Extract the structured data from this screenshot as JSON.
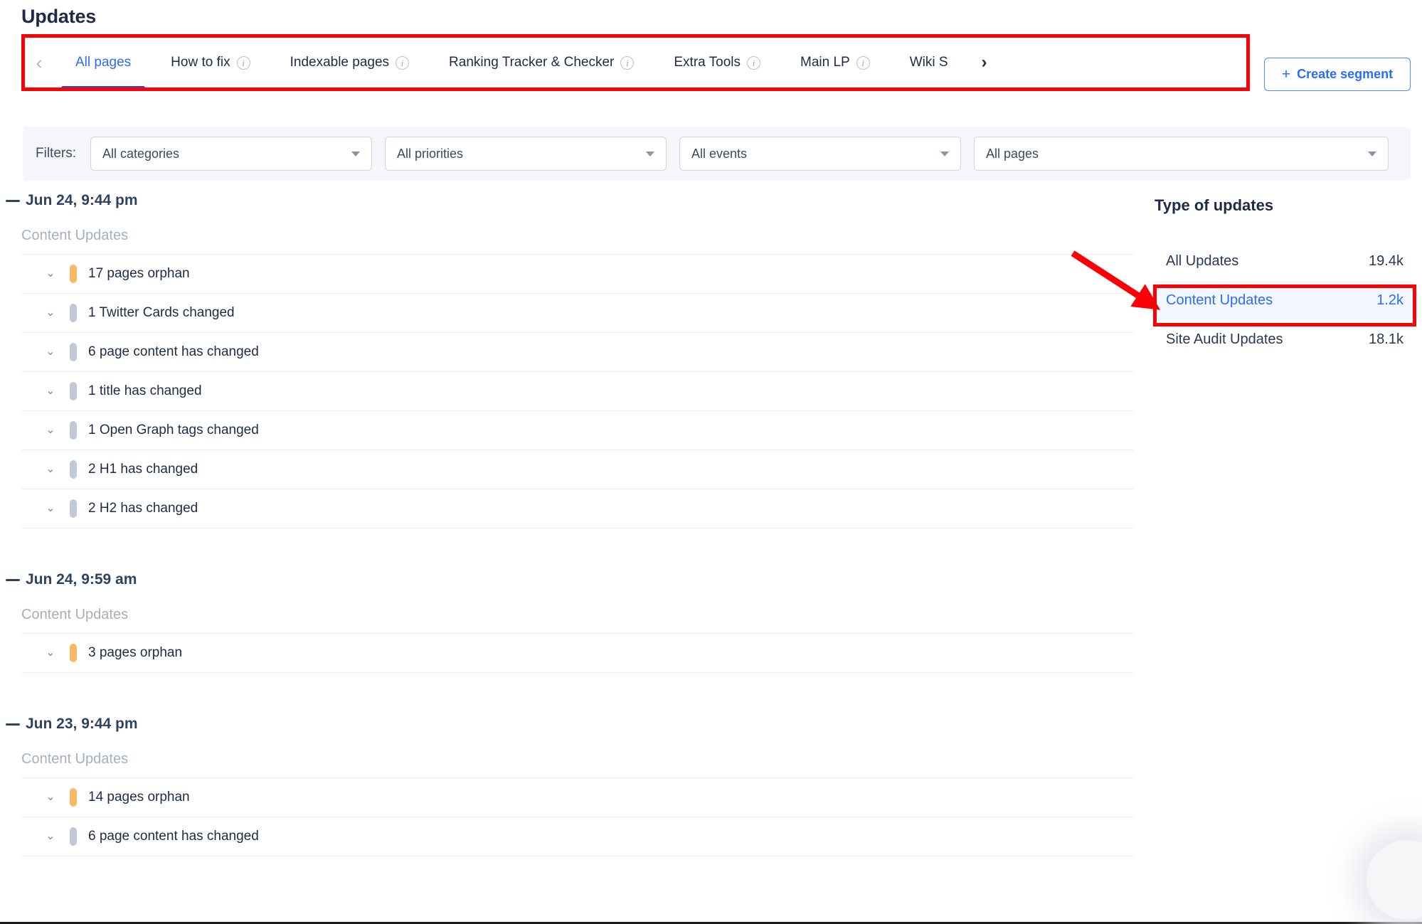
{
  "header": {
    "title": "Updates"
  },
  "tabs": {
    "prev_icon": "chevron-left-icon",
    "next_icon": "chevron-right-icon",
    "items": [
      {
        "label": "All pages",
        "active": true,
        "has_info": false
      },
      {
        "label": "How to fix",
        "active": false,
        "has_info": true
      },
      {
        "label": "Indexable pages",
        "active": false,
        "has_info": true
      },
      {
        "label": "Ranking Tracker & Checker",
        "active": false,
        "has_info": true
      },
      {
        "label": "Extra Tools",
        "active": false,
        "has_info": true
      },
      {
        "label": "Main LP",
        "active": false,
        "has_info": true
      },
      {
        "label": "Wiki S",
        "active": false,
        "has_info": false
      }
    ],
    "create_segment_label": "Create segment",
    "create_segment_plus": "+"
  },
  "filters": {
    "label": "Filters:",
    "selects": [
      {
        "value": "All categories",
        "placeholder": "All categories"
      },
      {
        "value": "All priorities",
        "placeholder": "All priorities"
      },
      {
        "value": "All events",
        "placeholder": "All events"
      },
      {
        "value": "All pages",
        "placeholder": "All pages"
      }
    ]
  },
  "timeline": {
    "groups": [
      {
        "date": "Jun 24, 9:44 pm",
        "section_label": "Content Updates",
        "rows": [
          {
            "label": "17 pages orphan",
            "severity": "orange"
          },
          {
            "label": "1 Twitter Cards changed",
            "severity": "grey"
          },
          {
            "label": "6 page content has changed",
            "severity": "grey"
          },
          {
            "label": "1 title has changed",
            "severity": "grey"
          },
          {
            "label": "1 Open Graph tags changed",
            "severity": "grey"
          },
          {
            "label": "2 H1 has changed",
            "severity": "grey"
          },
          {
            "label": "2 H2 has changed",
            "severity": "grey"
          }
        ]
      },
      {
        "date": "Jun 24, 9:59 am",
        "section_label": "Content Updates",
        "rows": [
          {
            "label": "3 pages orphan",
            "severity": "orange"
          }
        ]
      },
      {
        "date": "Jun 23, 9:44 pm",
        "section_label": "Content Updates",
        "rows": [
          {
            "label": "14 pages orphan",
            "severity": "orange"
          },
          {
            "label": "6 page content has changed",
            "severity": "grey"
          }
        ]
      }
    ]
  },
  "type_of_updates": {
    "title": "Type of updates",
    "items": [
      {
        "label": "All Updates",
        "count": "19.4k",
        "selected": false
      },
      {
        "label": "Content Updates",
        "count": "1.2k",
        "selected": true
      },
      {
        "label": "Site Audit Updates",
        "count": "18.1k",
        "selected": false
      }
    ]
  },
  "colors": {
    "accent_blue": "#2b6df6",
    "annotation_red": "#fb0007",
    "severity_orange": "#fab864",
    "severity_grey": "#c3c9d4",
    "text_dark": "#1f2b45",
    "muted": "#a7aebd"
  }
}
